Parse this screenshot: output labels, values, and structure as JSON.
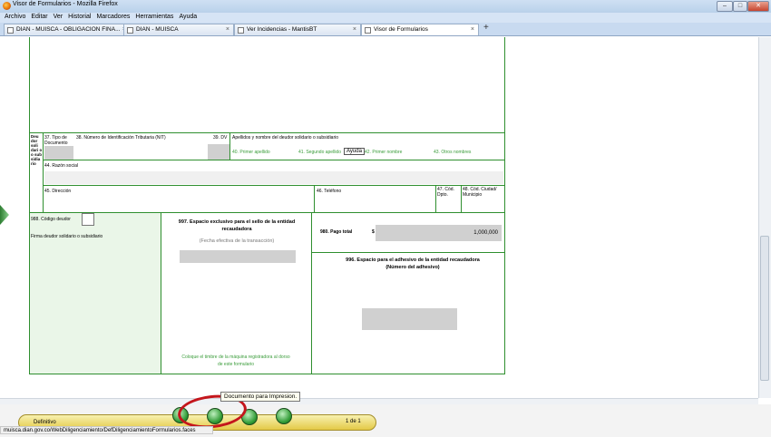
{
  "window": {
    "title": "Visor de Formularios - Mozilla Firefox"
  },
  "menu": [
    "Archivo",
    "Editar",
    "Ver",
    "Historial",
    "Marcadores",
    "Herramientas",
    "Ayuda"
  ],
  "tabs": [
    {
      "label": "DIAN - MUISCA - OBLIGACION FINA..."
    },
    {
      "label": "DIAN - MUISCA"
    },
    {
      "label": "Ver Incidencias - MantisBT"
    },
    {
      "label": "Visor de Formularios",
      "active": true
    }
  ],
  "new_tab_symbol": "+",
  "form": {
    "section_label": "Deu dor soli dari o o sub sidia rio",
    "f37": "37. Tipo de Documento",
    "f38": "38. Número de Identificación Tributaria (NIT)",
    "f39": "39. DV",
    "apellidos_header": "Apellidos y nombre del deudor solidario o subsidiario",
    "f40": "40. Primer apellido",
    "f41": "41. Segundo apellido",
    "f42": "42. Primer nombre",
    "f43": "43. Otros nombres",
    "f44": "44. Razón social",
    "f45": "45. Dirección",
    "f46": "46. Teléfono",
    "f47": "47. Cód. Dpto.",
    "f48": "48. Cód. Ciudad/ Municipio",
    "ayuda": "Ayuda",
    "f988": "988. Código deudor",
    "firma": "Firma deudor solidario o subsidiario",
    "f997_title": "997. Espacio exclusivo para el sello de la entidad recaudadora",
    "f997_sub": "(Fecha efectiva de la transacción)",
    "timbre": "Coloque el timbre de la máquina registradora al dorso de este formulario",
    "f980": "980. Pago total",
    "currency": "$",
    "pago_total": "1,000,000",
    "f996": "996. Espacio para el adhesivo de la entidad recaudadora (Número del adhesivo)"
  },
  "tooltip": "Documento para Impresion.",
  "status": {
    "left": "Definitivo",
    "url": "muisca.dian.gov.co/WebDiligenciamiento/DefDiligenciamientoFormularios.faces",
    "page": "1 de 1"
  }
}
